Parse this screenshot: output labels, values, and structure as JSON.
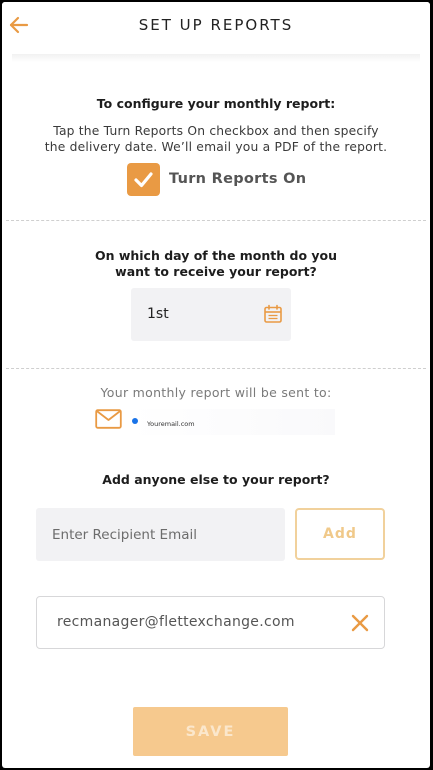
{
  "header": {
    "title": "SET UP REPORTS",
    "back_icon": "arrow-left-icon",
    "accent": "#e99a44"
  },
  "configure": {
    "heading": "To configure your monthly report:",
    "desc_line1": "Tap the Turn Reports On checkbox and then specify",
    "desc_line2": "the delivery date. We’ll email you a PDF of the report.",
    "checkbox_checked": true,
    "checkbox_label": "Turn Reports On"
  },
  "schedule": {
    "question_line1": "On which day of the month do you",
    "question_line2": "want to receive your report?",
    "day_value": "1st",
    "calendar_icon": "calendar-icon"
  },
  "delivery": {
    "sent_to_label": "Your monthly report will be sent to:",
    "mail_icon": "envelope-icon",
    "email": "Youremail.com"
  },
  "recipients": {
    "heading": "Add anyone else to your report?",
    "input_placeholder": "Enter Recipient Email",
    "add_label": "Add",
    "list": [
      {
        "email": "recmanager@flettexchange.com",
        "remove_icon": "close-icon"
      }
    ]
  },
  "footer": {
    "save_label": "SAVE"
  }
}
